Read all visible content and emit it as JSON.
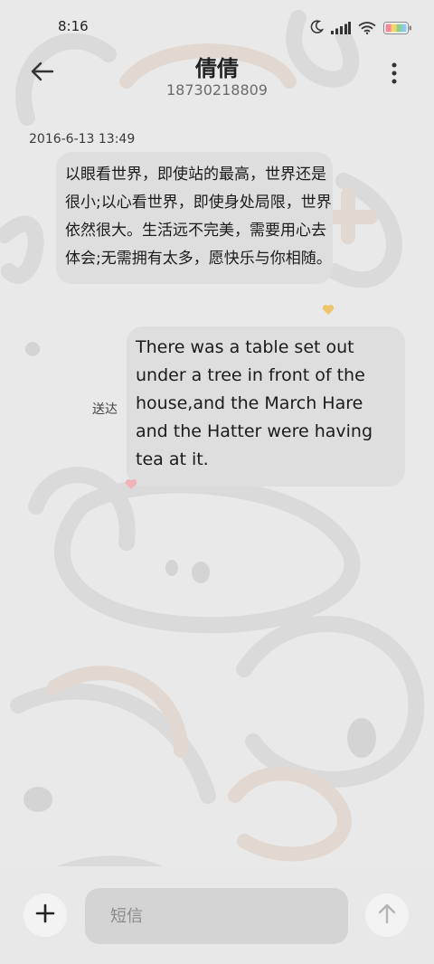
{
  "status_bar": {
    "time": "8:16",
    "icons": [
      "moon-icon",
      "signal-icon",
      "wifi-icon",
      "battery-icon"
    ]
  },
  "header": {
    "contact_name": "倩倩",
    "phone_number": "18730218809",
    "back_icon": "arrow-left-icon",
    "more_icon": "more-vertical-icon"
  },
  "conversation": {
    "timestamp": "2016-6-13 13:49",
    "messages": [
      {
        "direction": "incoming",
        "text": "以眼看世界，即使站的最高，世界还是很小;以心看世界，即使身处局限，世界依然很大。生活远不完美，需要用心去体会;无需拥有太多，愿快乐与你相随。"
      },
      {
        "direction": "outgoing",
        "text": "There was a table set out under a tree in front of the house,and the March Hare and the Hatter were having tea at it.",
        "status": "送达"
      }
    ]
  },
  "composer": {
    "placeholder": "短信",
    "value": "",
    "add_icon": "plus-icon",
    "send_icon": "arrow-up-icon"
  },
  "colors": {
    "background": "#e9e9e9",
    "bubble": "#dedede",
    "composer_bar": "#e8e8e8",
    "input_field": "#d4d4d4",
    "heart_incoming": "#f0c46a",
    "heart_outgoing": "#f3b2b8"
  }
}
